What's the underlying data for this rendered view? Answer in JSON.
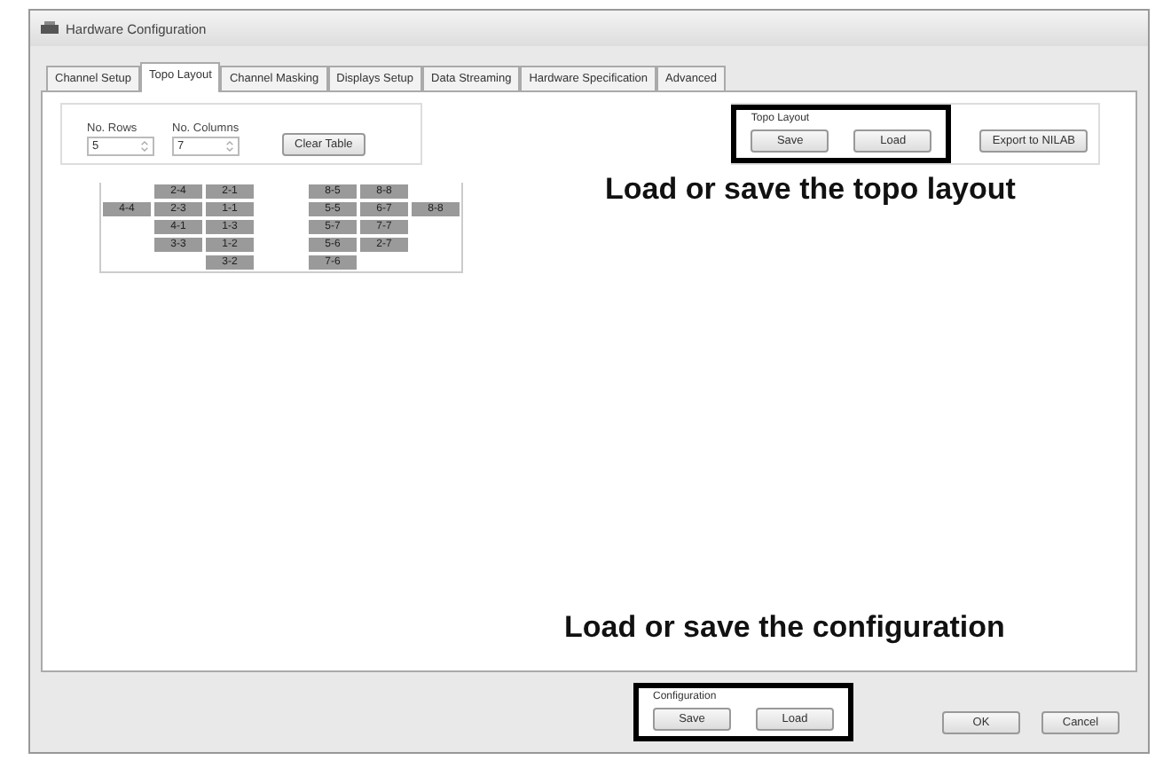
{
  "window": {
    "title": "Hardware Configuration"
  },
  "tabs": [
    {
      "label": "Channel Setup",
      "selected": false
    },
    {
      "label": "Topo Layout",
      "selected": true
    },
    {
      "label": "Channel Masking",
      "selected": false
    },
    {
      "label": "Displays Setup",
      "selected": false
    },
    {
      "label": "Data Streaming",
      "selected": false
    },
    {
      "label": "Hardware Specification",
      "selected": false
    },
    {
      "label": "Advanced",
      "selected": false
    }
  ],
  "size": {
    "rows": {
      "label": "No. Rows",
      "value": "5"
    },
    "columns": {
      "label": "No. Columns",
      "value": "7"
    },
    "clear_button": "Clear Table"
  },
  "topo_layout": {
    "title": "Topo Layout",
    "buttons": [
      "Save",
      "Load"
    ],
    "export_button": "Export to NILAB"
  },
  "grid": [
    [
      {
        "kind": "empty"
      },
      {
        "kind": "filled",
        "text": "2-4"
      },
      {
        "kind": "filled",
        "text": "2-1"
      },
      {
        "kind": "empty"
      },
      {
        "kind": "filled",
        "text": "8-5"
      },
      {
        "kind": "filled",
        "text": "8-8"
      },
      {
        "kind": "empty"
      }
    ],
    [
      {
        "kind": "filled",
        "text": "4-4"
      },
      {
        "kind": "filled",
        "text": "2-3"
      },
      {
        "kind": "filled",
        "text": "1-1"
      },
      {
        "kind": "empty"
      },
      {
        "kind": "filled",
        "text": "5-5"
      },
      {
        "kind": "filled",
        "text": "6-7"
      },
      {
        "kind": "filled",
        "text": "8-8"
      }
    ],
    [
      {
        "kind": "empty"
      },
      {
        "kind": "filled",
        "text": "4-1"
      },
      {
        "kind": "filled",
        "text": "1-3"
      },
      {
        "kind": "empty"
      },
      {
        "kind": "filled",
        "text": "5-7"
      },
      {
        "kind": "filled",
        "text": "7-7"
      },
      {
        "kind": "empty"
      }
    ],
    [
      {
        "kind": "empty"
      },
      {
        "kind": "filled",
        "text": "3-3"
      },
      {
        "kind": "filled",
        "text": "1-2"
      },
      {
        "kind": "empty"
      },
      {
        "kind": "filled",
        "text": "5-6"
      },
      {
        "kind": "filled",
        "text": "2-7"
      },
      {
        "kind": "empty"
      }
    ],
    [
      {
        "kind": "empty"
      },
      {
        "kind": "empty"
      },
      {
        "kind": "filled",
        "text": "3-2"
      },
      {
        "kind": "empty"
      },
      {
        "kind": "filled",
        "text": "7-6"
      },
      {
        "kind": "empty"
      },
      {
        "kind": "empty"
      }
    ]
  ],
  "configuration": {
    "title": "Configuration",
    "buttons": [
      "Save",
      "Load"
    ]
  },
  "dialog_buttons": [
    "OK",
    "Cancel"
  ],
  "annotations": [
    {
      "text": "Load or save the topo layout",
      "kind": "topo"
    },
    {
      "text": "Load or save the configuration",
      "kind": "config"
    }
  ]
}
